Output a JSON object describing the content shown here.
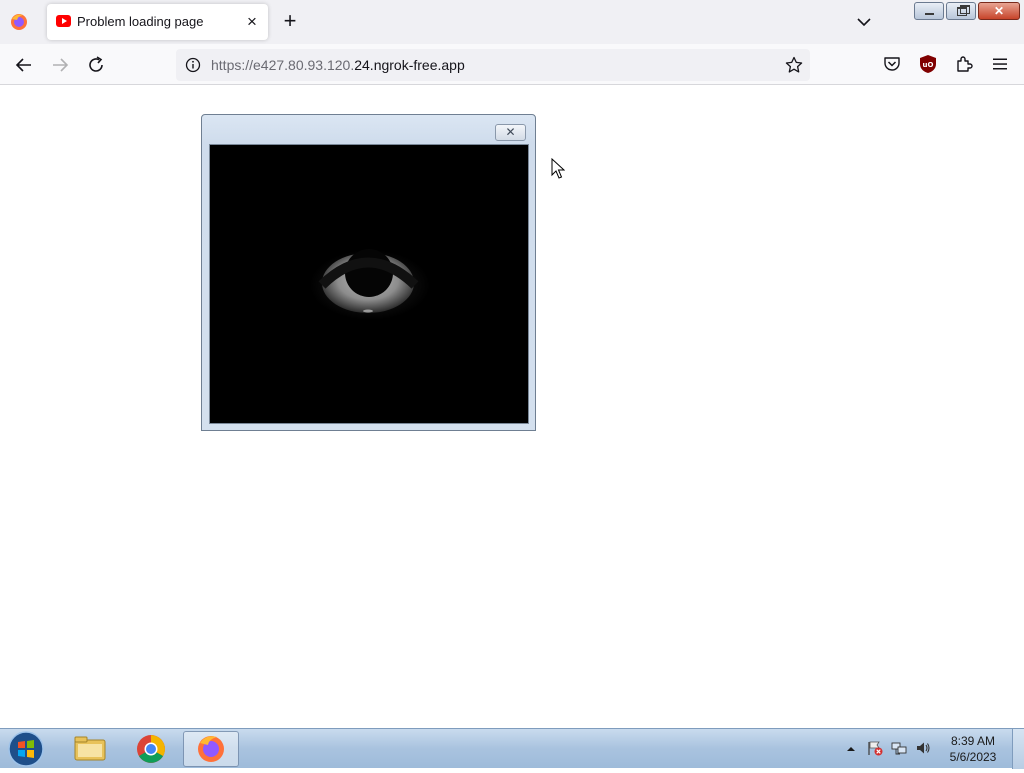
{
  "browser": {
    "tab": {
      "title": "Problem loading page",
      "favicon": "youtube-icon"
    },
    "url": {
      "dim_part": "https://e427.80.93.120.",
      "main_part": "24.ngrok-free.app"
    },
    "icons": {
      "back": "back-arrow-icon",
      "forward": "forward-arrow-icon",
      "reload": "reload-icon",
      "info": "info-icon",
      "bookmark": "star-icon",
      "pocket": "pocket-icon",
      "ublock": "ublock-origin-icon",
      "extensions": "extensions-icon",
      "menu": "hamburger-menu-icon"
    }
  },
  "popup": {
    "close_glyph": "✕",
    "content": "eye-image"
  },
  "taskbar": {
    "items": [
      "Windows Explorer",
      "Google Chrome",
      "Firefox"
    ],
    "active_item": "Firefox",
    "clock": {
      "time": "8:39 AM",
      "date": "5/6/2023"
    }
  },
  "colors": {
    "youtube_red": "#ff0000",
    "ublock_red": "#800000",
    "firefox_orange": "#ff7139"
  }
}
